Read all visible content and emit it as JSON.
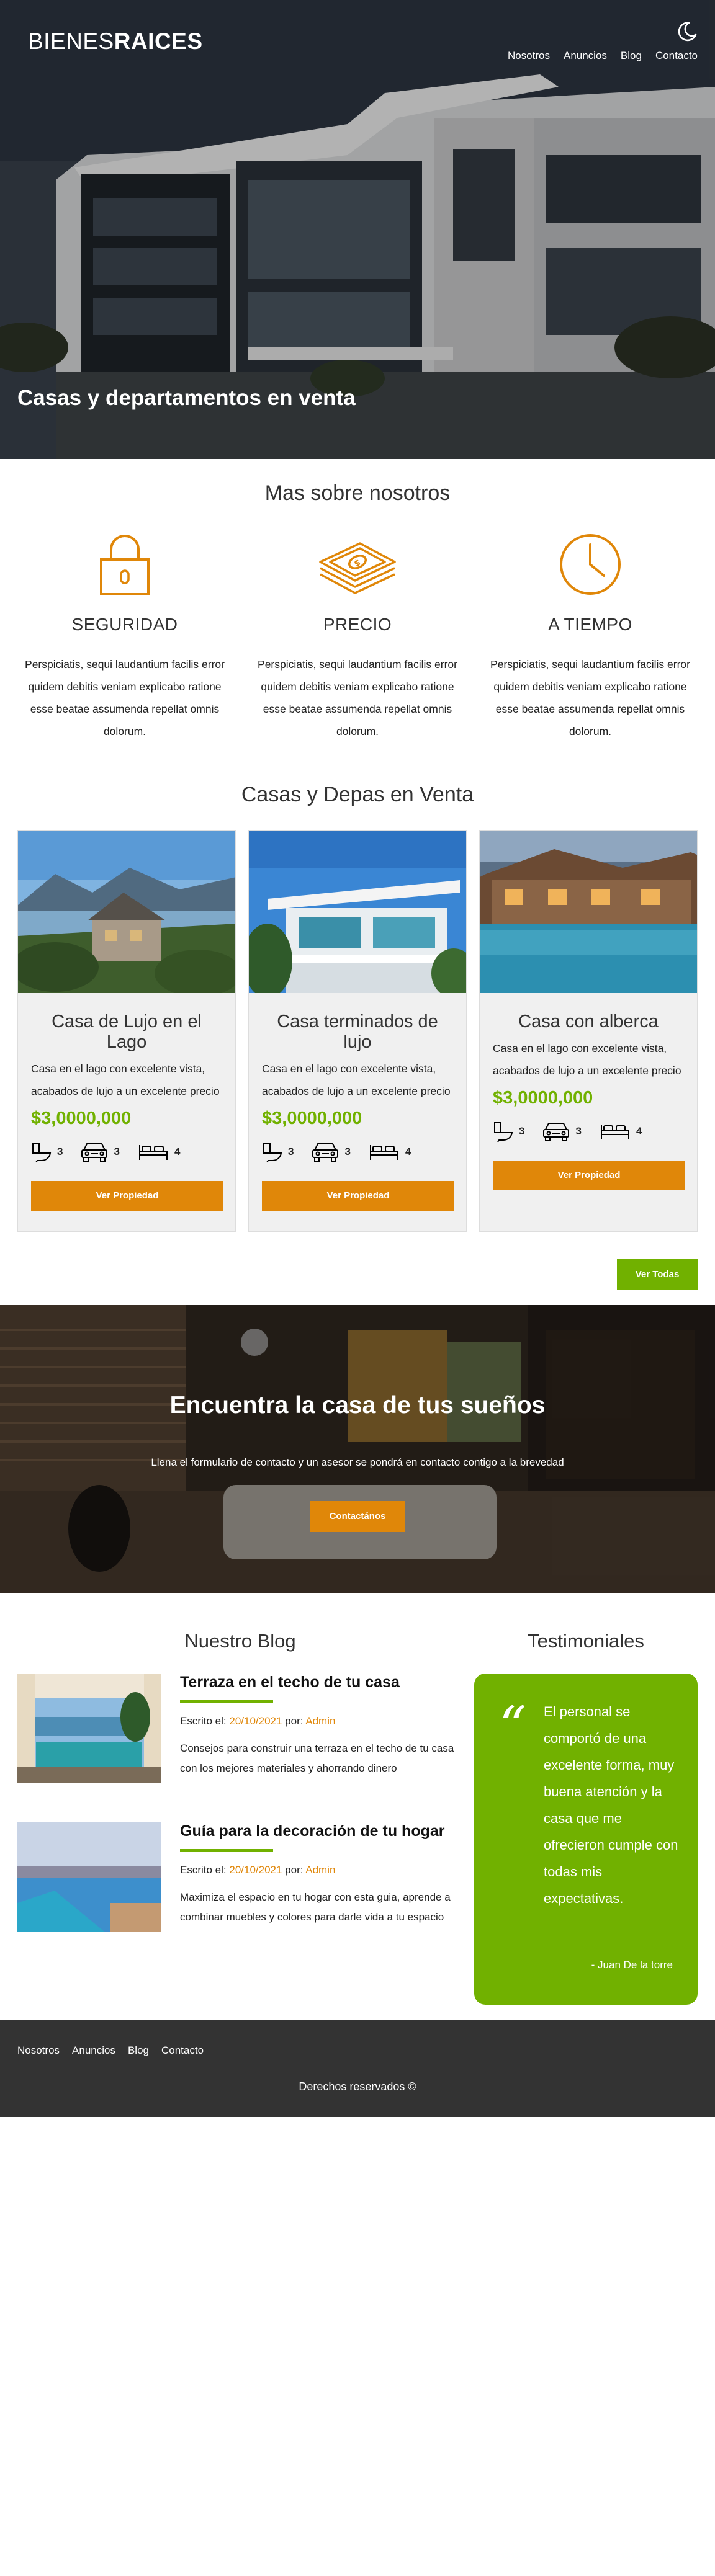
{
  "header": {
    "logo_light": "BIENES",
    "logo_bold": "RAICES",
    "nav": [
      "Nosotros",
      "Anuncios",
      "Blog",
      "Contacto"
    ],
    "dark_mode_icon": "moon-icon",
    "hero_title": "Casas y departamentos en venta"
  },
  "about": {
    "title": "Mas sobre nosotros",
    "features": [
      {
        "icon": "lock-icon",
        "title": "SEGURIDAD",
        "text": "Perspiciatis, sequi laudantium facilis error quidem debitis veniam explicabo ratione esse beatae assumenda repellat omnis dolorum."
      },
      {
        "icon": "money-icon",
        "title": "PRECIO",
        "text": "Perspiciatis, sequi laudantium facilis error quidem debitis veniam explicabo ratione esse beatae assumenda repellat omnis dolorum."
      },
      {
        "icon": "clock-icon",
        "title": "A TIEMPO",
        "text": "Perspiciatis, sequi laudantium facilis error quidem debitis veniam explicabo ratione esse beatae assumenda repellat omnis dolorum."
      }
    ]
  },
  "listings": {
    "title": "Casas y Depas en Venta",
    "cards": [
      {
        "title": "Casa de Lujo en el Lago",
        "desc": "Casa en el lago con excelente vista, acabados de lujo a un excelente precio",
        "price": "$3,0000,000",
        "wc": "3",
        "parking": "3",
        "rooms": "4",
        "button": "Ver Propiedad"
      },
      {
        "title": "Casa terminados de lujo",
        "desc": "Casa en el lago con excelente vista, acabados de lujo a un excelente precio",
        "price": "$3,0000,000",
        "wc": "3",
        "parking": "3",
        "rooms": "4",
        "button": "Ver Propiedad"
      },
      {
        "title": "Casa con alberca",
        "desc": "Casa en el lago con excelente vista, acabados de lujo a un excelente precio",
        "price": "$3,0000,000",
        "wc": "3",
        "parking": "3",
        "rooms": "4",
        "button": "Ver Propiedad"
      }
    ],
    "view_all": "Ver Todas"
  },
  "contact_banner": {
    "title": "Encuentra la casa de tus sueños",
    "text": "Llena el formulario de contacto y un asesor se pondrá en contacto contigo a la brevedad",
    "button": "Contactános"
  },
  "blog": {
    "title": "Nuestro Blog",
    "posts": [
      {
        "title": "Terraza en el techo de tu casa",
        "written_label": "Escrito el: ",
        "date": "20/10/2021",
        "by_label": " por: ",
        "author": "Admin",
        "excerpt": "Consejos para construir una terraza en el techo de tu casa con los mejores materiales y ahorrando dinero"
      },
      {
        "title": "Guía para la decoración de tu hogar",
        "written_label": "Escrito el: ",
        "date": "20/10/2021",
        "by_label": " por: ",
        "author": "Admin",
        "excerpt": "Maximiza el espacio en tu hogar con esta guia, aprende a combinar muebles y colores para darle vida a tu espacio"
      }
    ]
  },
  "testimonials": {
    "title": "Testimoniales",
    "quote": "El personal se comportó de una excelente forma, muy buena atención y la casa que me ofrecieron cumple con todas mis expectativas.",
    "author": "- Juan De la torre"
  },
  "footer": {
    "links": [
      "Nosotros",
      "Anuncios",
      "Blog",
      "Contacto"
    ],
    "copyright": "Derechos reservados ©"
  },
  "colors": {
    "accent_orange": "#e08709",
    "accent_green": "#71b100",
    "footer_bg": "#333333"
  }
}
